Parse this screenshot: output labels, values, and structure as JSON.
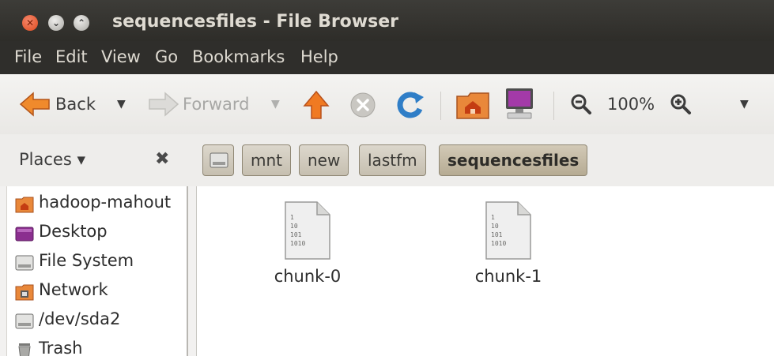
{
  "window": {
    "title": "sequencesfiles - File Browser"
  },
  "menubar": {
    "items": [
      "File",
      "Edit",
      "View",
      "Go",
      "Bookmarks",
      "Help"
    ]
  },
  "toolbar": {
    "back_label": "Back",
    "forward_label": "Forward",
    "zoom_level": "100%",
    "icons": {
      "back": "back-arrow-icon",
      "forward": "forward-arrow-icon",
      "up": "up-arrow-icon",
      "stop": "stop-icon",
      "reload": "reload-icon",
      "home": "home-folder-icon",
      "computer": "computer-icon",
      "zoom_out": "zoom-out-icon",
      "zoom_in": "zoom-in-icon"
    }
  },
  "pathbar": {
    "places_label": "Places ▾",
    "crumbs": [
      "mnt",
      "new",
      "lastfm",
      "sequencesfiles"
    ],
    "active_crumb": "sequencesfiles"
  },
  "sidebar": {
    "items": [
      {
        "label": "hadoop-mahout",
        "icon": "home-folder-icon"
      },
      {
        "label": "Desktop",
        "icon": "desktop-icon"
      },
      {
        "label": "File System",
        "icon": "drive-icon"
      },
      {
        "label": "Network",
        "icon": "network-icon"
      },
      {
        "label": "/dev/sda2",
        "icon": "drive-icon"
      },
      {
        "label": "Trash",
        "icon": "trash-icon"
      }
    ]
  },
  "files": [
    {
      "name": "chunk-0",
      "icon": "binary-file-icon"
    },
    {
      "name": "chunk-1",
      "icon": "binary-file-icon"
    }
  ],
  "colors": {
    "titlebar": "#3d3c38",
    "close_button": "#de4b1f",
    "crumb_active": "#b6ab93"
  }
}
